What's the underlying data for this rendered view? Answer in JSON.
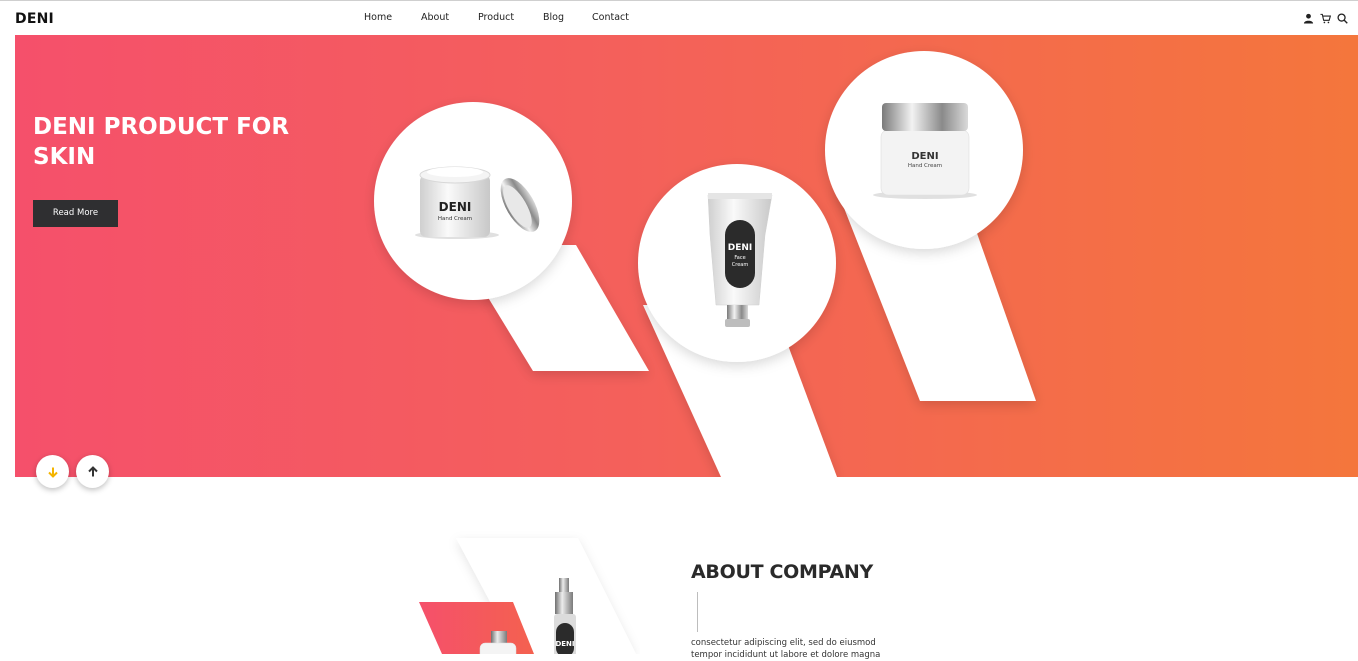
{
  "brand": {
    "logo": "DENI"
  },
  "nav": {
    "items": [
      {
        "label": "Home"
      },
      {
        "label": "About"
      },
      {
        "label": "Product"
      },
      {
        "label": "Blog"
      },
      {
        "label": "Contact"
      }
    ]
  },
  "header_icons": [
    "user-icon",
    "cart-icon",
    "search-icon"
  ],
  "hero": {
    "title": "DENI PRODUCT FOR SKIN",
    "button_label": "Read More",
    "products": [
      {
        "brand": "DENI",
        "name": "Hand Cream"
      },
      {
        "brand": "DENI",
        "name": "Face Cream"
      },
      {
        "brand": "DENI",
        "name": "Hand Cream"
      }
    ]
  },
  "scroll_buttons": [
    "arrow-down-icon",
    "arrow-up-icon"
  ],
  "about": {
    "title": "ABOUT COMPANY",
    "text_line1": "consectetur adipiscing elit, sed do eiusmod",
    "text_line2": "tempor incididunt ut labore et dolore magna",
    "bottle_label": "DENI"
  },
  "colors": {
    "gradient_start": "#f5506b",
    "gradient_end": "#f4763c",
    "button_dark": "#2f2f31",
    "arrow_yellow": "#f4b400"
  }
}
